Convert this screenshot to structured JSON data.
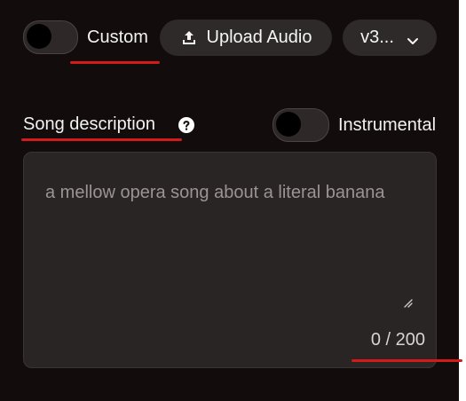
{
  "controls": {
    "custom_label": "Custom",
    "upload_audio_label": "Upload Audio",
    "version_label": "v3...",
    "custom_toggle_on": false
  },
  "description": {
    "heading": "Song description",
    "help_icon": "question-circle-icon",
    "instrumental_label": "Instrumental",
    "instrumental_toggle_on": false,
    "placeholder": "a mellow opera song about a literal banana",
    "char_count": "0 / 200"
  },
  "icons": {
    "upload": "upload-icon",
    "chevron": "chevron-down-icon",
    "help": "question-circle-icon",
    "resize": "resize-handle-icon"
  },
  "colors": {
    "background": "#120c0c",
    "control_bg": "#2f2a2a",
    "annotation_red": "#d41a1a"
  }
}
